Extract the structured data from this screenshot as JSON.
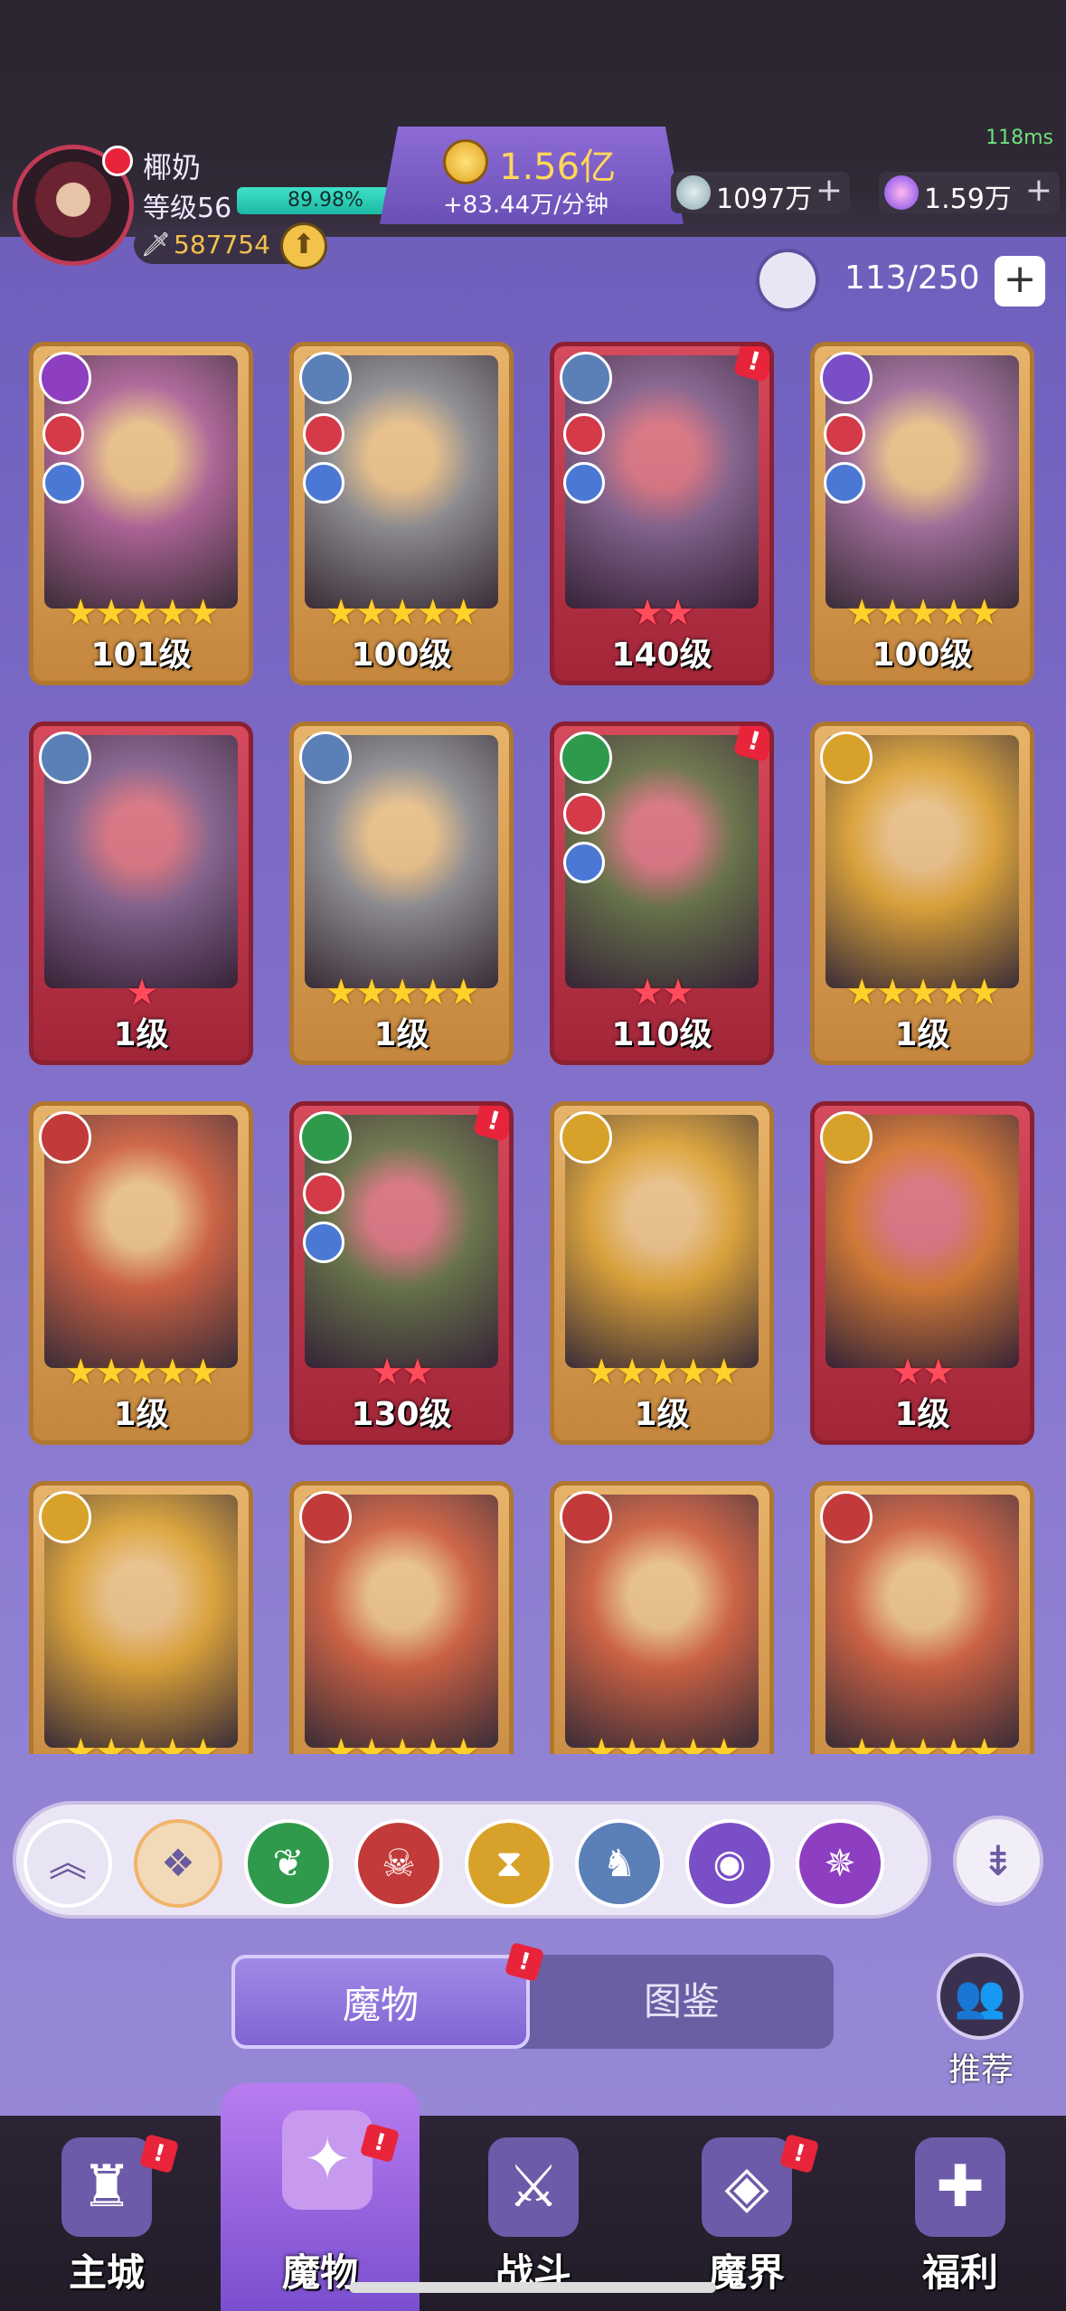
{
  "status": {
    "ping": "118ms"
  },
  "player": {
    "name": "椰奶",
    "level": "等级56",
    "xp_percent_text": "89.98%",
    "xp_fraction": 0.8998,
    "power": "587754"
  },
  "currency": {
    "gold": "1.56亿",
    "gold_rate": "+83.44万/分钟",
    "silver": "1097万",
    "gems": "1.59万"
  },
  "capacity": "113/250",
  "cards": [
    {
      "level": "101级",
      "stars": 5,
      "star_color": "yellow",
      "frame": "gold",
      "element_color": "#8e3ec0",
      "alert": false
    },
    {
      "level": "100级",
      "stars": 5,
      "star_color": "yellow",
      "frame": "gold",
      "element_color": "#5b7fb7",
      "alert": false
    },
    {
      "level": "140级",
      "stars": 2,
      "star_color": "red",
      "frame": "red",
      "element_color": "#5b7fb7",
      "alert": true
    },
    {
      "level": "100级",
      "stars": 5,
      "star_color": "yellow",
      "frame": "gold",
      "element_color": "#7a4ec7",
      "alert": false
    },
    {
      "level": "1级",
      "stars": 1,
      "star_color": "red",
      "frame": "red",
      "element_color": "#5b7fb7",
      "alert": false
    },
    {
      "level": "1级",
      "stars": 5,
      "star_color": "yellow",
      "frame": "gold",
      "element_color": "#5b7fb7",
      "alert": false
    },
    {
      "level": "110级",
      "stars": 2,
      "star_color": "red",
      "frame": "red",
      "element_color": "#2f9a4b",
      "alert": true
    },
    {
      "level": "1级",
      "stars": 5,
      "star_color": "yellow",
      "frame": "gold",
      "element_color": "#d8a22a",
      "alert": false
    },
    {
      "level": "1级",
      "stars": 5,
      "star_color": "yellow",
      "frame": "gold",
      "element_color": "#c23a3a",
      "alert": false
    },
    {
      "level": "130级",
      "stars": 2,
      "star_color": "red",
      "frame": "red",
      "element_color": "#2f9a4b",
      "alert": true
    },
    {
      "level": "1级",
      "stars": 5,
      "star_color": "yellow",
      "frame": "gold",
      "element_color": "#d8a22a",
      "alert": false
    },
    {
      "level": "1级",
      "stars": 2,
      "star_color": "red",
      "frame": "red",
      "element_color": "#d8a22a",
      "alert": false
    },
    {
      "level": "",
      "stars": 5,
      "star_color": "yellow",
      "frame": "gold",
      "element_color": "#d8a22a",
      "alert": false
    },
    {
      "level": "",
      "stars": 5,
      "star_color": "yellow",
      "frame": "gold",
      "element_color": "#c23a3a",
      "alert": false
    },
    {
      "level": "",
      "stars": 5,
      "star_color": "yellow",
      "frame": "gold",
      "element_color": "#c23a3a",
      "alert": false
    },
    {
      "level": "",
      "stars": 5,
      "star_color": "yellow",
      "frame": "gold",
      "element_color": "#c23a3a",
      "alert": false
    }
  ],
  "filters": [
    {
      "name": "collapse",
      "color": "#e9e4f4",
      "icon": "︽"
    },
    {
      "name": "all",
      "color": "#f2d9b8",
      "icon": "❖"
    },
    {
      "name": "nature",
      "color": "#2f9a4b",
      "icon": "❦"
    },
    {
      "name": "demon",
      "color": "#c23a3a",
      "icon": "☠"
    },
    {
      "name": "time",
      "color": "#d8a22a",
      "icon": "⧗"
    },
    {
      "name": "dragon",
      "color": "#5b7fb7",
      "icon": "♞"
    },
    {
      "name": "eye",
      "color": "#7a4ec7",
      "icon": "◉"
    },
    {
      "name": "spiral",
      "color": "#8e3ec0",
      "icon": "✵"
    }
  ],
  "tabs": {
    "monsters": "魔物",
    "codex": "图鉴"
  },
  "recommend_label": "推荐",
  "nav": [
    {
      "label": "主城",
      "alert": true,
      "color": "#6d5aa8",
      "icon": "♜"
    },
    {
      "label": "魔物",
      "alert": true,
      "color": "#c79af0",
      "icon": "✦"
    },
    {
      "label": "战斗",
      "alert": false,
      "color": "#6d5aa8",
      "icon": "⚔"
    },
    {
      "label": "魔界",
      "alert": true,
      "color": "#6d5aa8",
      "icon": "◈"
    },
    {
      "label": "福利",
      "alert": false,
      "color": "#6d5aa8",
      "icon": "✚"
    }
  ]
}
